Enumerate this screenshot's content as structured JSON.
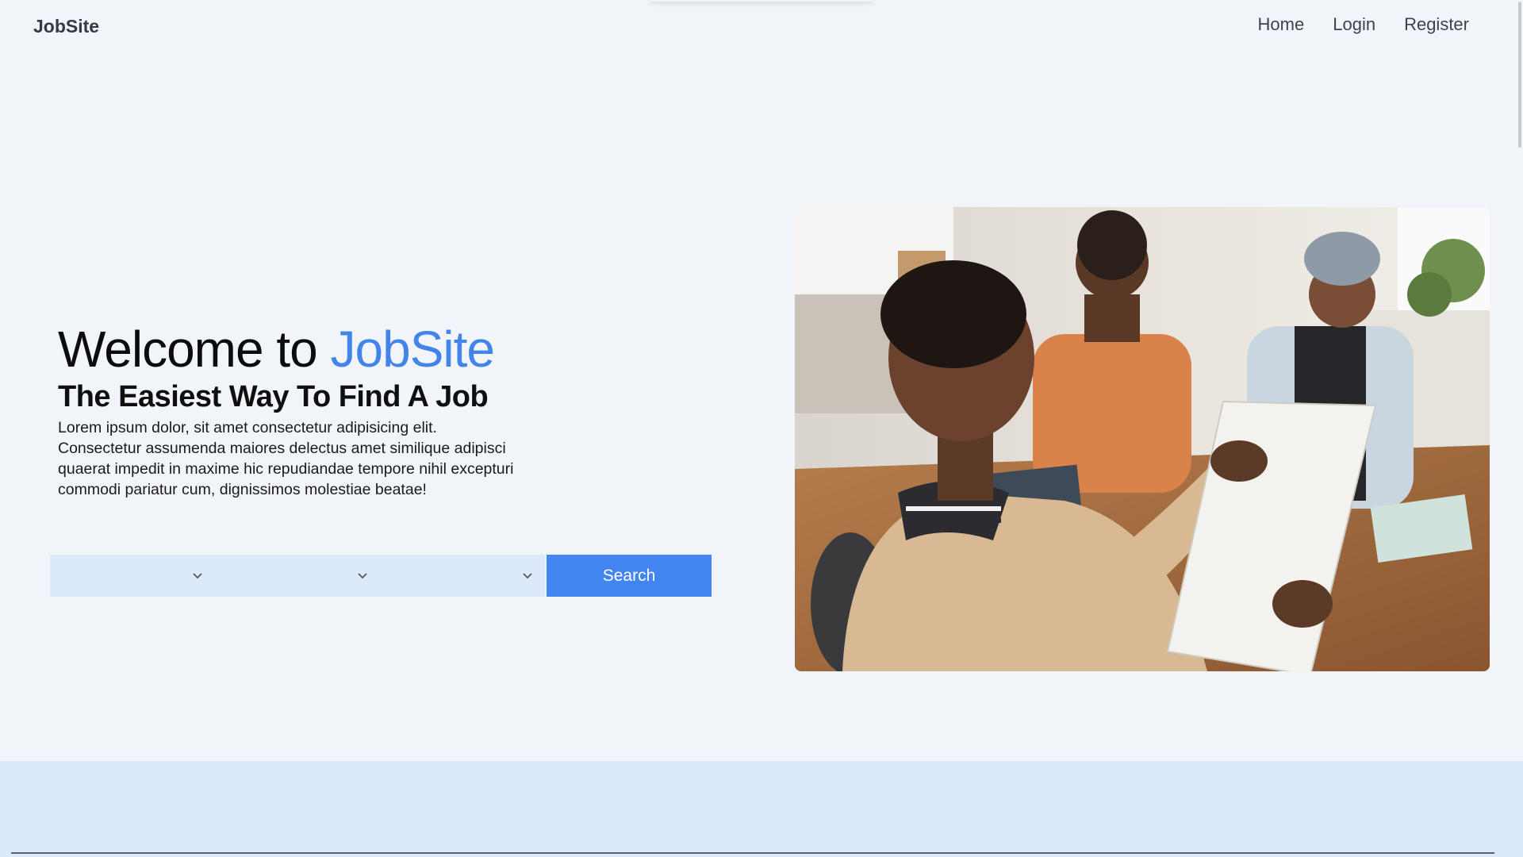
{
  "header": {
    "brand": "JobSite",
    "nav": [
      {
        "label": "Home"
      },
      {
        "label": "Login"
      },
      {
        "label": "Register"
      }
    ]
  },
  "hero": {
    "title_prefix": "Welcome to ",
    "title_accent": "JobSite",
    "subtitle": "The Easiest Way To Find A Job",
    "body": "Lorem ipsum dolor, sit amet consectetur adipisicing elit. Consectetur assumenda maiores delectus amet similique adipisci quaerat impedit in maxime hic repudiandae tempore nihil excepturi commodi pariatur cum, dignissimos molestiae beatae!"
  },
  "search": {
    "selects": [
      {
        "value": ""
      },
      {
        "value": ""
      },
      {
        "value": ""
      }
    ],
    "button_label": "Search"
  },
  "colors": {
    "accent": "#4284e8",
    "button": "#4285f0",
    "select_bg": "#dce9fb",
    "page_bg": "#f1f5fa",
    "band_bg": "#dce9fd"
  },
  "icons": {
    "select_chevron": "chevron-down-icon"
  }
}
